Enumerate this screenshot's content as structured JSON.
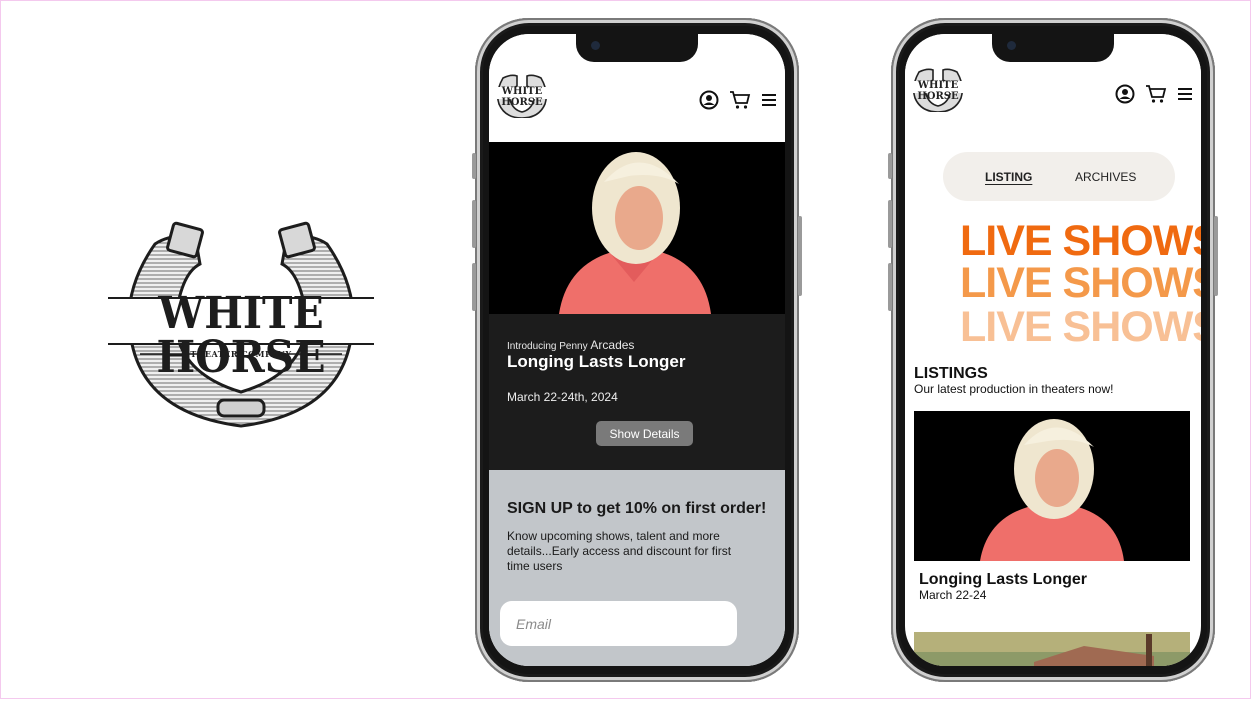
{
  "logo": {
    "title": "WHITE HORSE",
    "subtitle": "THEATER COMPANY"
  },
  "header_icons": [
    "user-circle-icon",
    "cart-icon",
    "hamburger-menu-icon"
  ],
  "phone1": {
    "mini_logo": "WHITE HORSE",
    "event": {
      "intro_small": "Introducing Penny",
      "intro_name": "Arcades",
      "title": "Longing Lasts Longer",
      "date": "March 22-24th, 2024",
      "button": "Show Details"
    },
    "signup": {
      "title": "SIGN UP to get 10% on first order!",
      "text": "Know upcoming shows, talent and more details...Early access and discount for first time users",
      "email_placeholder": "Email"
    }
  },
  "phone2": {
    "mini_logo": "WHITE HORSE",
    "tabs": [
      {
        "label": "LISTING",
        "active": true
      },
      {
        "label": "ARCHIVES",
        "active": false
      }
    ],
    "banner": [
      "LIVE SHOWS",
      "LIVE SHOWS",
      "LIVE SHOWS"
    ],
    "banner_colors": [
      "#f06a10",
      "#f4994a",
      "#f8c095"
    ],
    "listings_heading": "LISTINGS",
    "listings_sub": "Our latest production in theaters now!",
    "listing": {
      "title": "Longing Lasts Longer",
      "date": "March 22-24"
    }
  }
}
